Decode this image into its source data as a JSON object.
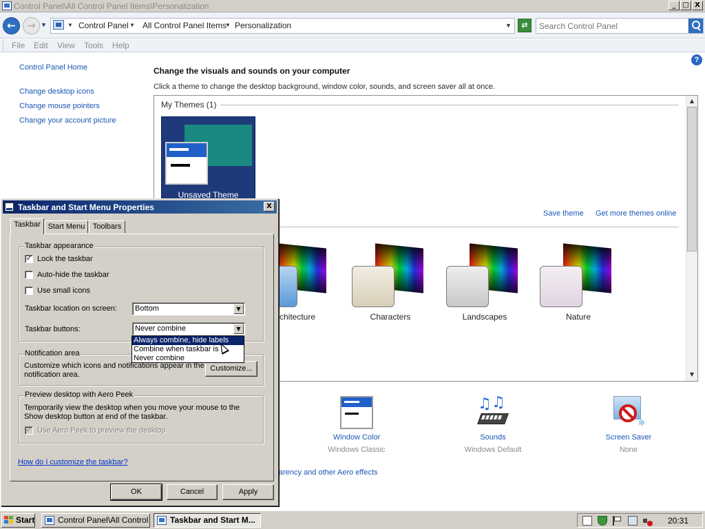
{
  "window": {
    "title": "Control Panel\\All Control Panel Items\\Personalization",
    "min": "_",
    "max": "□",
    "close": "X"
  },
  "address": {
    "crumbs": [
      "Control Panel",
      "All Control Panel Items",
      "Personalization"
    ],
    "search_placeholder": "Search Control Panel"
  },
  "menubar": [
    "File",
    "Edit",
    "View",
    "Tools",
    "Help"
  ],
  "leftnav": {
    "home": "Control Panel Home",
    "links": [
      "Change desktop icons",
      "Change mouse pointers",
      "Change your account picture"
    ]
  },
  "main": {
    "heading": "Change the visuals and sounds on your computer",
    "subheading": "Click a theme to change the desktop background, window color, sounds, and screen saver all at once.",
    "my_themes": "My Themes (1)",
    "unsaved_theme": "Unsaved Theme",
    "save_theme": "Save theme",
    "more_themes": "Get more themes online",
    "themes": [
      "Architecture",
      "Characters",
      "Landscapes",
      "Nature"
    ],
    "bottom": [
      {
        "label": "Window Color",
        "sub": "Windows Classic"
      },
      {
        "label": "Sounds",
        "sub": "Windows Default"
      },
      {
        "label": "Screen Saver",
        "sub": "None"
      }
    ],
    "aero_link_fragment": "arency and other Aero effects"
  },
  "dialog": {
    "title": "Taskbar and Start Menu Properties",
    "close": "X",
    "tabs": [
      "Taskbar",
      "Start Menu",
      "Toolbars"
    ],
    "appearance": {
      "legend": "Taskbar appearance",
      "lock": "Lock the taskbar",
      "autohide": "Auto-hide the taskbar",
      "small_icons": "Use small icons",
      "location_label": "Taskbar location on screen:",
      "location_value": "Bottom",
      "buttons_label": "Taskbar buttons:",
      "buttons_value": "Never combine",
      "buttons_options": [
        "Always combine, hide labels",
        "Combine when taskbar is f",
        "Never combine"
      ]
    },
    "notification": {
      "legend": "Notification area",
      "text": "Customize which icons and notifications appear in the notification area.",
      "customize": "Customize..."
    },
    "aero": {
      "legend": "Preview desktop with Aero Peek",
      "text": "Temporarily view the desktop when you move your mouse to the Show desktop button at end of the taskbar.",
      "checkbox": "Use Aero Peek to preview the desktop"
    },
    "help_link": "How do I customize the taskbar?",
    "ok": "OK",
    "cancel": "Cancel",
    "apply": "Apply"
  },
  "taskbar": {
    "start": "Start",
    "tasks": [
      "Control Panel\\All Control ...",
      "Taskbar and Start M..."
    ],
    "clock": "20:31"
  }
}
